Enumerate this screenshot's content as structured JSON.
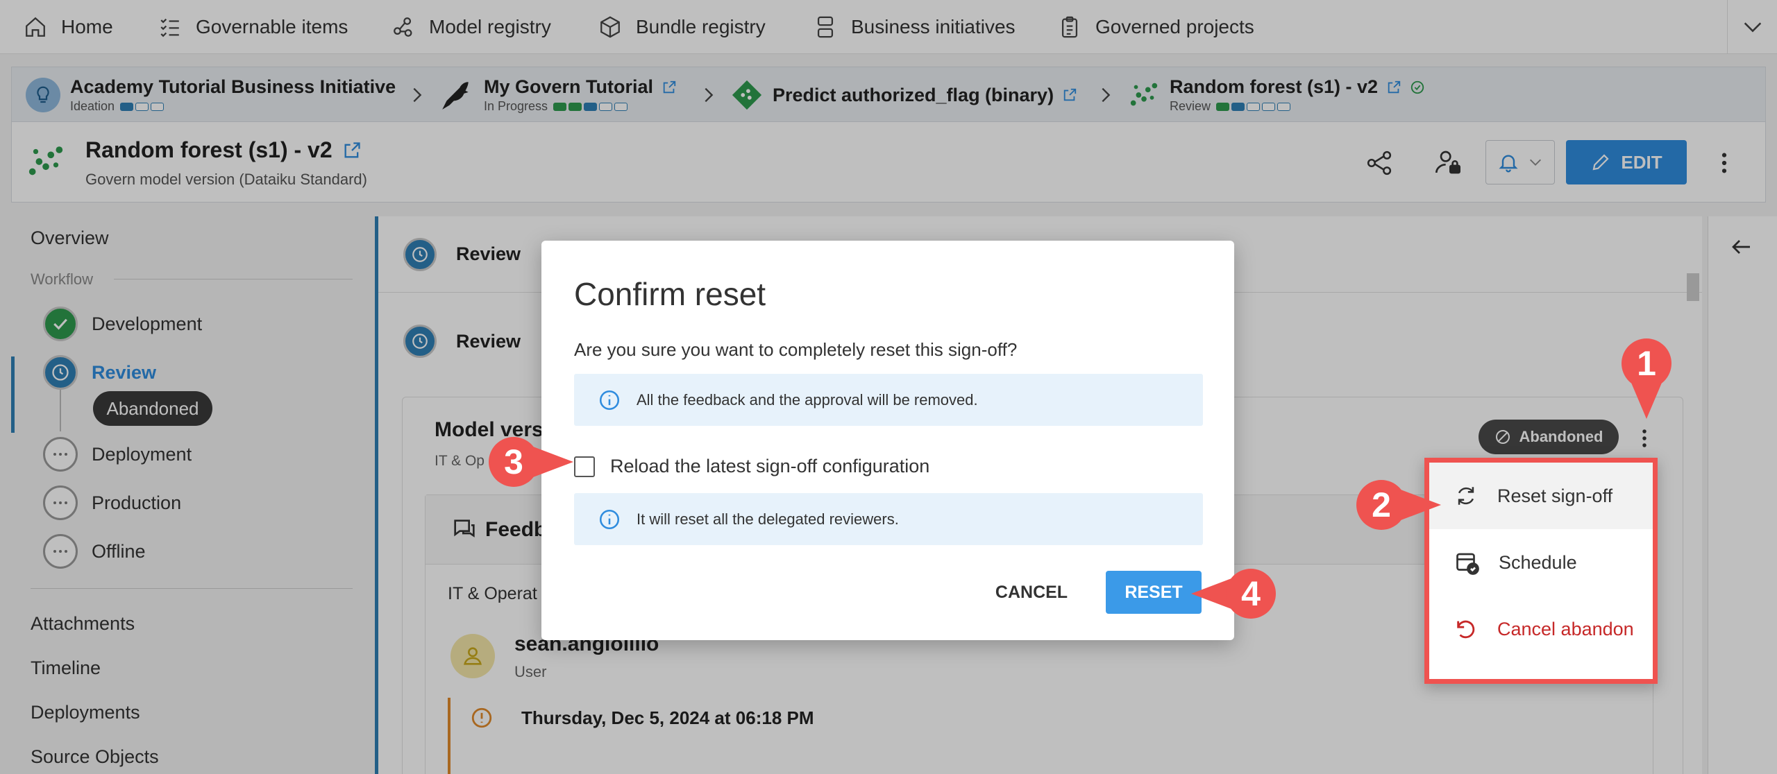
{
  "nav": {
    "items": [
      {
        "label": "Home",
        "icon": "home-icon"
      },
      {
        "label": "Governable items",
        "icon": "checklist-icon"
      },
      {
        "label": "Model registry",
        "icon": "model-icon"
      },
      {
        "label": "Bundle registry",
        "icon": "box-icon"
      },
      {
        "label": "Business initiatives",
        "icon": "initiative-icon"
      },
      {
        "label": "Governed projects",
        "icon": "clipboard-icon"
      }
    ]
  },
  "breadcrumb": [
    {
      "title": "Academy Tutorial Business Initiative",
      "status": "Ideation"
    },
    {
      "title": "My Govern Tutorial",
      "status": "In Progress"
    },
    {
      "title": "Predict authorized_flag (binary)",
      "status": ""
    },
    {
      "title": "Random forest (s1) - v2",
      "status": "Review"
    }
  ],
  "header": {
    "title": "Random forest (s1) - v2",
    "subtitle": "Govern model version (Dataiku Standard)",
    "edit_label": "EDIT"
  },
  "sidebar": {
    "overview": "Overview",
    "workflow_label": "Workflow",
    "steps": [
      {
        "label": "Development",
        "state": "done"
      },
      {
        "label": "Review",
        "state": "current"
      },
      {
        "label": "Deployment",
        "state": "pending"
      },
      {
        "label": "Production",
        "state": "pending"
      },
      {
        "label": "Offline",
        "state": "pending"
      }
    ],
    "review_badge": "Abandoned",
    "links": [
      "Attachments",
      "Timeline",
      "Deployments",
      "Source Objects"
    ]
  },
  "main": {
    "review_row_1": "Review",
    "review_row_2": "Review",
    "card_title": "Model vers",
    "card_subtitle": "IT & Op",
    "abandoned_badge": "Abandoned",
    "feedback_title": "Feedb",
    "feedback_group": "IT & Operat",
    "user_name": "sean.angiolillo",
    "user_role": "User",
    "feedback_date": "Thursday, Dec 5, 2024 at 06:18 PM"
  },
  "dialog": {
    "title": "Confirm reset",
    "question": "Are you sure you want to completely reset this sign-off?",
    "info_1": "All the feedback and the approval will be removed.",
    "checkbox_label": "Reload the latest sign-off configuration",
    "checkbox_checked": false,
    "info_2": "It will reset all the delegated reviewers.",
    "cancel_label": "CANCEL",
    "reset_label": "RESET"
  },
  "context_menu": {
    "items": [
      {
        "label": "Reset sign-off",
        "icon": "refresh-icon"
      },
      {
        "label": "Schedule",
        "icon": "calendar-icon"
      },
      {
        "label": "Cancel abandon",
        "icon": "undo-icon"
      }
    ]
  },
  "callouts": [
    "1",
    "2",
    "3",
    "4"
  ],
  "colors": {
    "accent": "#2f8cde",
    "callout": "#ef5350",
    "success": "#2e9a4e",
    "danger": "#c62828"
  }
}
